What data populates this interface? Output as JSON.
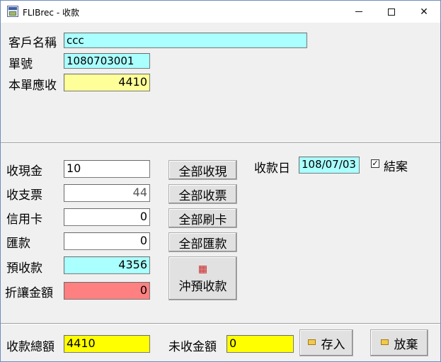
{
  "window": {
    "title": "FLIBrec - 收款"
  },
  "header": {
    "customer_label": "客戶名稱",
    "customer_value": "ccc",
    "order_label": "單號",
    "order_value": "1080703001",
    "receivable_label": "本單應收",
    "receivable_value": "4410"
  },
  "payment": {
    "cash_label": "收現金",
    "cash_value": "10",
    "check_label": "收支票",
    "check_value": "44",
    "credit_label": "信用卡",
    "credit_value": "0",
    "remit_label": "匯款",
    "remit_value": "0",
    "prepaid_label": "預收款",
    "prepaid_value": "4356",
    "discount_label": "折讓金額",
    "discount_value": "0"
  },
  "buttons": {
    "all_cash": "全部收現",
    "all_check": "全部收票",
    "all_card": "全部刷卡",
    "all_remit": "全部匯款",
    "offset_prepaid": "沖預收款",
    "save": "存入",
    "discard": "放棄"
  },
  "date": {
    "label": "收款日",
    "value": "108/07/03"
  },
  "close": {
    "label": "結案",
    "checked": true,
    "mark": "✓"
  },
  "footer": {
    "total_label": "收款總額",
    "total_value": "4410",
    "outstanding_label": "未收金額",
    "outstanding_value": "0"
  },
  "colors": {
    "cyan": "#aaffff",
    "light_yellow": "#ffff99",
    "yellow": "#ffff00",
    "pink": "#ff8080"
  }
}
